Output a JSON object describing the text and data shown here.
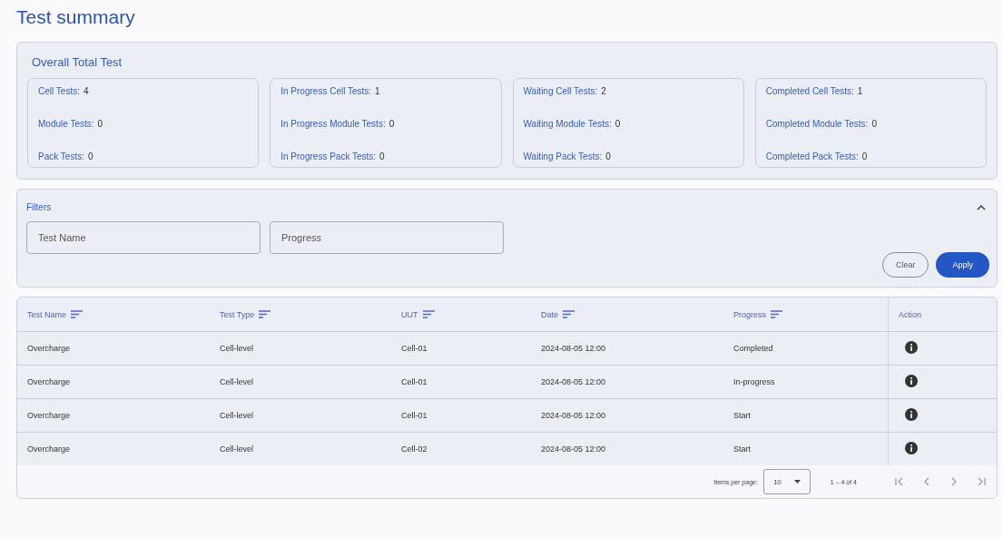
{
  "page_title": "Test summary",
  "summary": {
    "title": "Overall Total Test",
    "cards": [
      {
        "stats": [
          {
            "label": "Cell Tests:",
            "value": "4"
          },
          {
            "label": "Module Tests:",
            "value": "0"
          },
          {
            "label": "Pack Tests:",
            "value": "0"
          }
        ]
      },
      {
        "stats": [
          {
            "label": "In Progress Cell Tests:",
            "value": "1"
          },
          {
            "label": "In Progress Module Tests:",
            "value": "0"
          },
          {
            "label": "In Progress Pack Tests:",
            "value": "0"
          }
        ]
      },
      {
        "stats": [
          {
            "label": "Waiting Cell Tests:",
            "value": "2"
          },
          {
            "label": "Waiting Module Tests:",
            "value": "0"
          },
          {
            "label": "Waiting Pack Tests:",
            "value": "0"
          }
        ]
      },
      {
        "stats": [
          {
            "label": "Completed Cell Tests:",
            "value": "1"
          },
          {
            "label": "Completed Module Tests:",
            "value": "0"
          },
          {
            "label": "Completed Pack Tests:",
            "value": "0"
          }
        ]
      }
    ]
  },
  "filters": {
    "title": "Filters",
    "expanded": true,
    "fields": [
      {
        "placeholder": "Test Name"
      },
      {
        "placeholder": "Progress"
      }
    ],
    "buttons": [
      {
        "label": "Clear",
        "kind": "outline"
      },
      {
        "label": "Apply",
        "kind": "primary"
      }
    ]
  },
  "table": {
    "columns": [
      {
        "label": "Test Name",
        "sortable": true
      },
      {
        "label": "Test Type",
        "sortable": true
      },
      {
        "label": "UUT",
        "sortable": true
      },
      {
        "label": "Date",
        "sortable": true
      },
      {
        "label": "Progress",
        "sortable": true
      },
      {
        "label": "Action",
        "sortable": false
      }
    ],
    "rows": [
      [
        "Overcharge",
        "Cell-level",
        "Cell-01",
        "2024-08-05 12:00",
        "Completed"
      ],
      [
        "Overcharge",
        "Cell-level",
        "Cell-01",
        "2024-08-05 12:00",
        "In-progress"
      ],
      [
        "Overcharge",
        "Cell-level",
        "Cell-01",
        "2024-08-05 12:00",
        "Start"
      ],
      [
        "Overcharge",
        "Cell-level",
        "Cell-02",
        "2024-08-05 12:00",
        "Start"
      ]
    ]
  },
  "paginator": {
    "label": "Items per page:",
    "page_size": "10",
    "range": "1 – 4 of 4"
  }
}
